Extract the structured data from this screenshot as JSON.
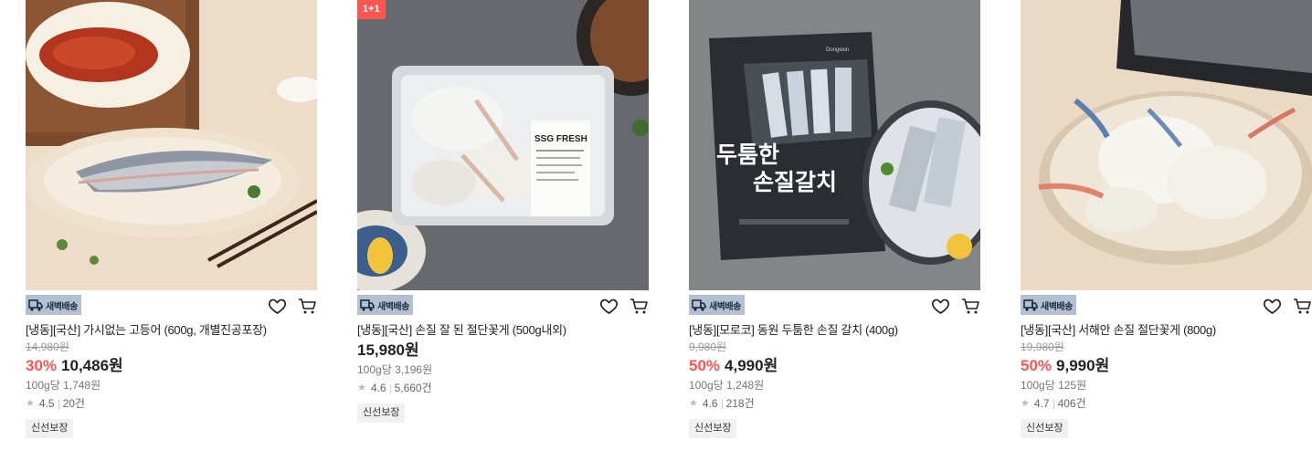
{
  "products": [
    {
      "name": "[냉동][국산] 가시없는 고등어 (600g, 개별진공포장)",
      "original_price": "14,980원",
      "discount": "30%",
      "price": "10,486원",
      "unit_price": "100g당 1,748원",
      "rating": "4.5",
      "reviews": "20건",
      "tag": "신선보장",
      "delivery_badge": "새벽배송",
      "promo": ""
    },
    {
      "name": "[냉동][국산] 손질 잘 된 절단꽃게 (500g내외)",
      "original_price": "",
      "discount": "",
      "price": "15,980원",
      "unit_price": "100g당 3,196원",
      "rating": "4.6",
      "reviews": "5,660건",
      "tag": "신선보장",
      "delivery_badge": "새벽배송",
      "promo": "1+1"
    },
    {
      "name": "[냉동][모로코] 동원 두툼한 손질 갈치 (400g)",
      "original_price": "9,980원",
      "discount": "50%",
      "price": "4,990원",
      "unit_price": "100g당 1,248원",
      "rating": "4.6",
      "reviews": "218건",
      "tag": "신선보장",
      "delivery_badge": "새벽배송",
      "promo": "",
      "package_text": [
        "두툼한",
        "손질갈치"
      ],
      "package_brand": "Dongwon"
    },
    {
      "name": "[냉동][국산] 서해안 손질 절단꽃게 (800g)",
      "original_price": "19,980원",
      "discount": "50%",
      "price": "9,990원",
      "unit_price": "100g당 125원",
      "rating": "4.7",
      "reviews": "406건",
      "tag": "신선보장",
      "delivery_badge": "새벽배송",
      "promo": ""
    }
  ],
  "image_labels": {
    "crab_tray_label": "SSG FRESH"
  },
  "icons": {
    "wishlist": "heart-icon",
    "cart": "cart-icon",
    "delivery": "truck-icon",
    "rating": "star-icon"
  },
  "colors": {
    "discount": "#ff5452",
    "badge_bg": "#b3c0d1",
    "tag_bg": "#f1f1f1"
  }
}
